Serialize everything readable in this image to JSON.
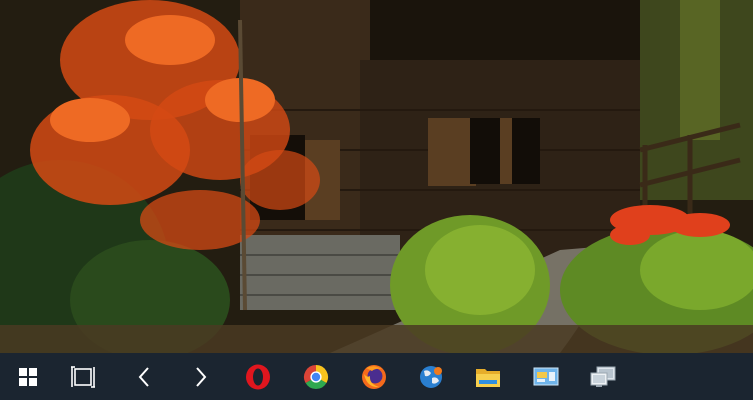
{
  "desktop": {
    "wallpaper": "autumn-barn-wallpaper"
  },
  "taskbar": {
    "background": "#1b2530",
    "items": [
      {
        "name": "start-button",
        "icon": "windows-logo-icon"
      },
      {
        "name": "task-view-button",
        "icon": "task-view-icon"
      },
      {
        "name": "back-button",
        "icon": "chevron-left-icon"
      },
      {
        "name": "forward-button",
        "icon": "chevron-right-icon"
      },
      {
        "name": "opera-button",
        "icon": "opera-icon",
        "color": "#e0161e"
      },
      {
        "name": "chrome-button",
        "icon": "chrome-icon"
      },
      {
        "name": "firefox-button",
        "icon": "firefox-icon"
      },
      {
        "name": "network-globe-button",
        "icon": "globe-icon"
      },
      {
        "name": "file-explorer-button",
        "icon": "folder-icon",
        "color": "#f2c33d"
      },
      {
        "name": "control-panel-button",
        "icon": "control-panel-icon"
      },
      {
        "name": "remote-desktop-button",
        "icon": "remote-desktop-icon"
      }
    ]
  }
}
